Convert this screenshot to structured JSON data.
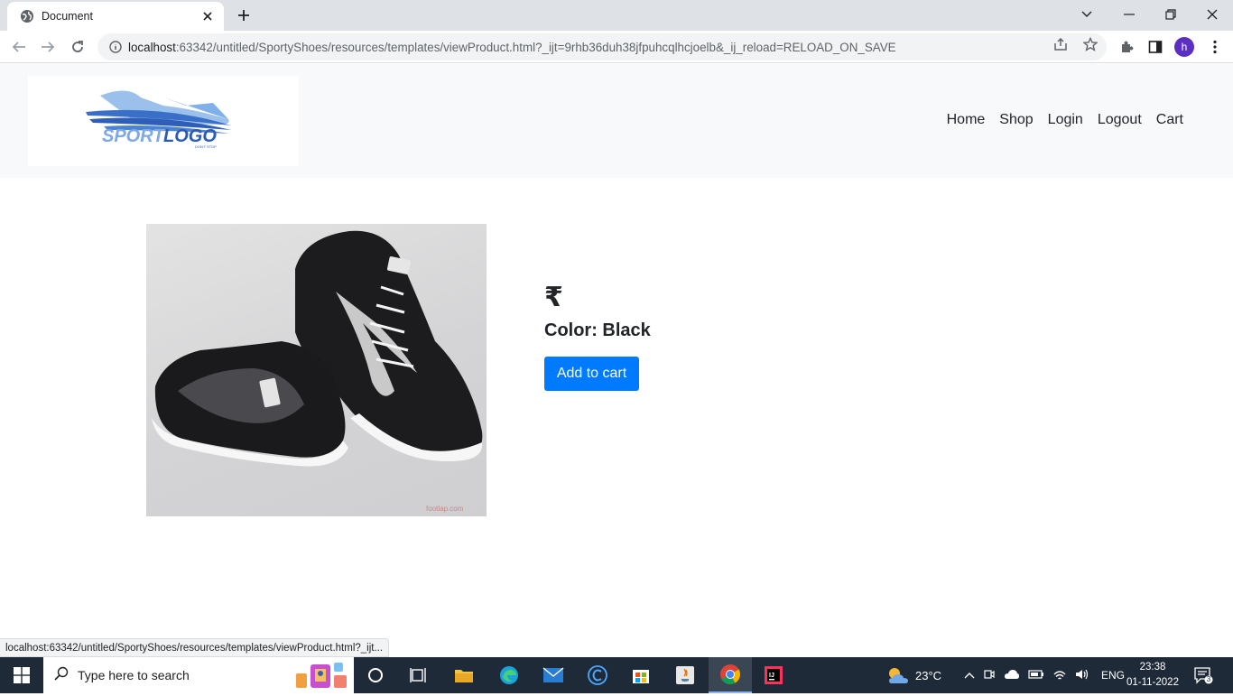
{
  "browser": {
    "tab_title": "Document",
    "url_host": "localhost",
    "url_rest": ":63342/untitled/SportyShoes/resources/templates/viewProduct.html?_ijt=9rhb36duh38jfpuhcqlhcjoelb&_ij_reload=RELOAD_ON_SAVE",
    "profile_initial": "h",
    "status_url": "localhost:63342/untitled/SportyShoes/resources/templates/viewProduct.html?_ijt..."
  },
  "site": {
    "logo": {
      "brand_text": "SPORTLOGO",
      "tagline": "DON'T STOP"
    },
    "nav": [
      {
        "label": "Home"
      },
      {
        "label": "Shop"
      },
      {
        "label": "Login"
      },
      {
        "label": "Logout"
      },
      {
        "label": "Cart"
      }
    ]
  },
  "product": {
    "price": "₹",
    "color_line": "Color: Black",
    "add_to_cart_label": "Add to cart",
    "watermark": "footlap.com"
  },
  "taskbar": {
    "search_placeholder": "Type here to search",
    "weather": "23°C",
    "language": "ENG",
    "time": "23:38",
    "date": "01-11-2022",
    "notification_count": "3"
  },
  "colors": {
    "accent": "#007bff",
    "header_bg": "#f8f9fa",
    "taskbar_bg": "#1f2a38"
  }
}
